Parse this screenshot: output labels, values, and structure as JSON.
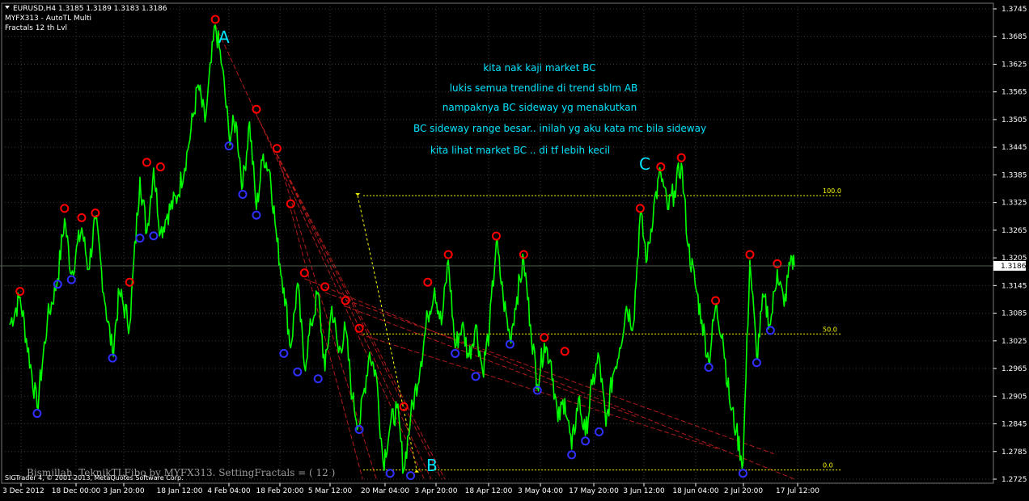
{
  "header": {
    "symbol_line": "EURUSD,H4  1.3185 1.3189 1.3183 1.3186",
    "indicator_1": "MYFX313 - AutoTL Multi",
    "indicator_2": "Fractals  12 th Lvl"
  },
  "notes": [
    "kita nak kaji market BC",
    "lukis semua trendline di trend sblm AB",
    "nampaknya BC sideway yg menakutkan",
    "BC sideway range besar.. inilah yg aku kata mc bila sideway",
    "kita lihat market BC .. di tf lebih kecil"
  ],
  "point_labels": {
    "a": "A",
    "b": "B",
    "c": "C"
  },
  "fib_levels": [
    {
      "label": "100.0",
      "price": 1.334
    },
    {
      "label": "50.0",
      "price": 1.304
    },
    {
      "label": "0.0",
      "price": 1.2745
    }
  ],
  "current_price": "1.3186",
  "footer": {
    "caption": "Bismillah. TeknikTLFibo by MYFX313. SettingFractals = ( 12 )",
    "copyright": "SIGTrader 4, © 2001-2013, MetaQuotes Software Corp."
  },
  "colors": {
    "background": "#000000",
    "price_line": "#00ff00",
    "grid": "#3a3a3a",
    "fractal_up": "#ff0000",
    "fractal_down": "#2f2fff",
    "trendline": "#b21a1a",
    "fib": "#ffff00",
    "notes": "#00e5ff"
  },
  "chart_data": {
    "type": "line",
    "symbol": "EURUSD",
    "timeframe": "H4",
    "y_ticks": [
      "1.3745",
      "1.3685",
      "1.3625",
      "1.3565",
      "1.3505",
      "1.3445",
      "1.3385",
      "1.3325",
      "1.3265",
      "1.3205",
      "1.3145",
      "1.3085",
      "1.3025",
      "1.2965",
      "1.2905",
      "1.2845",
      "1.2785",
      "1.2725"
    ],
    "x_ticks": [
      "3 Dec 2012",
      "18 Dec 00:00",
      "3 Jan 20:00",
      "18 Jan 12:00",
      "4 Feb 04:00",
      "18 Feb 20:00",
      "5 Mar 12:00",
      "20 Mar 04:00",
      "3 Apr 20:00",
      "18 Apr 12:00",
      "3 May 04:00",
      "17 May 20:00",
      "3 Jun 12:00",
      "18 Jun 04:00",
      "2 Jul 20:00",
      "17 Jul 12:00"
    ],
    "ylim": [
      1.2725,
      1.3745
    ],
    "price_path": [
      [
        "3 Dec 2012",
        1.306
      ],
      [
        "6 Dec",
        1.312
      ],
      [
        "11 Dec",
        1.288
      ],
      [
        "14 Dec",
        1.307
      ],
      [
        "17 Dec",
        1.316
      ],
      [
        "19 Dec",
        1.329
      ],
      [
        "21 Dec",
        1.317
      ],
      [
        "24 Dec",
        1.327
      ],
      [
        "26 Dec",
        1.318
      ],
      [
        "28 Dec",
        1.329
      ],
      [
        "31 Dec",
        1.31
      ],
      [
        "2 Jan",
        1.3
      ],
      [
        "4 Jan",
        1.313
      ],
      [
        "7 Jan",
        1.306
      ],
      [
        "10 Jan",
        1.338
      ],
      [
        "12 Jan",
        1.326
      ],
      [
        "14 Jan",
        1.34
      ],
      [
        "16 Jan",
        1.326
      ],
      [
        "18 Jan",
        1.33
      ],
      [
        "21 Jan",
        1.334
      ],
      [
        "24 Jan",
        1.344
      ],
      [
        "27 Jan",
        1.358
      ],
      [
        "29 Jan",
        1.35
      ],
      [
        "1 Feb",
        1.371
      ],
      [
        "3 Feb",
        1.362
      ],
      [
        "5 Feb",
        1.347
      ],
      [
        "7 Feb",
        1.35
      ],
      [
        "9 Feb",
        1.336
      ],
      [
        "11 Feb",
        1.35
      ],
      [
        "13 Feb",
        1.331
      ],
      [
        "15 Feb",
        1.343
      ],
      [
        "17 Feb",
        1.339
      ],
      [
        "19 Feb",
        1.324
      ],
      [
        "21 Feb",
        1.314
      ],
      [
        "23 Feb",
        1.301
      ],
      [
        "25 Feb",
        1.315
      ],
      [
        "27 Feb",
        1.297
      ],
      [
        "1 Mar",
        1.306
      ],
      [
        "3 Mar",
        1.313
      ],
      [
        "5 Mar",
        1.296
      ],
      [
        "7 Mar",
        1.31
      ],
      [
        "9 Mar",
        1.3
      ],
      [
        "11 Mar",
        1.305
      ],
      [
        "13 Mar",
        1.29
      ],
      [
        "15 Mar",
        1.284
      ],
      [
        "18 Mar",
        1.3
      ],
      [
        "20 Mar",
        1.295
      ],
      [
        "22 Mar",
        1.276
      ],
      [
        "24 Mar",
        1.284
      ],
      [
        "26 Mar",
        1.288
      ],
      [
        "28 Mar",
        1.2745
      ],
      [
        "30 Mar",
        1.286
      ],
      [
        "2 Apr",
        1.298
      ],
      [
        "4 Apr",
        1.308
      ],
      [
        "6 Apr",
        1.314
      ],
      [
        "8 Apr",
        1.306
      ],
      [
        "10 Apr",
        1.32
      ],
      [
        "12 Apr",
        1.301
      ],
      [
        "14 Apr",
        1.306
      ],
      [
        "16 Apr",
        1.299
      ],
      [
        "18 Apr",
        1.306
      ],
      [
        "20 Apr",
        1.296
      ],
      [
        "22 Apr",
        1.305
      ],
      [
        "24 Apr",
        1.324
      ],
      [
        "26 Apr",
        1.312
      ],
      [
        "28 Apr",
        1.303
      ],
      [
        "30 Apr",
        1.312
      ],
      [
        "2 May",
        1.32
      ],
      [
        "4 May",
        1.306
      ],
      [
        "6 May",
        1.293
      ],
      [
        "8 May",
        1.302
      ],
      [
        "10 May",
        1.298
      ],
      [
        "12 May",
        1.285
      ],
      [
        "14 May",
        1.29
      ],
      [
        "16 May",
        1.279
      ],
      [
        "18 May",
        1.29
      ],
      [
        "20 May",
        1.282
      ],
      [
        "22 May",
        1.293
      ],
      [
        "24 May",
        1.299
      ],
      [
        "26 May",
        1.284
      ],
      [
        "28 May",
        1.295
      ],
      [
        "30 May",
        1.301
      ],
      [
        "1 Jun",
        1.31
      ],
      [
        "3 Jun",
        1.306
      ],
      [
        "5 Jun",
        1.33
      ],
      [
        "7 Jun",
        1.32
      ],
      [
        "9 Jun",
        1.332
      ],
      [
        "11 Jun",
        1.339
      ],
      [
        "13 Jun",
        1.331
      ],
      [
        "15 Jun",
        1.335
      ],
      [
        "17 Jun",
        1.341
      ],
      [
        "19 Jun",
        1.323
      ],
      [
        "21 Jun",
        1.315
      ],
      [
        "23 Jun",
        1.307
      ],
      [
        "25 Jun",
        1.298
      ],
      [
        "27 Jun",
        1.31
      ],
      [
        "29 Jun",
        1.304
      ],
      [
        "1 Jul",
        1.29
      ],
      [
        "3 Jul",
        1.283
      ],
      [
        "5 Jul",
        1.276
      ],
      [
        "7 Jul",
        1.32
      ],
      [
        "9 Jul",
        1.299
      ],
      [
        "11 Jul",
        1.312
      ],
      [
        "13 Jul",
        1.306
      ],
      [
        "15 Jul",
        1.318
      ],
      [
        "17 Jul",
        1.31
      ],
      [
        "19 Jul",
        1.321
      ],
      [
        "20 Jul",
        1.3186
      ]
    ],
    "fractals_up": [
      [
        "6 Dec",
        1.312
      ],
      [
        "19 Dec",
        1.33
      ],
      [
        "24 Dec",
        1.328
      ],
      [
        "28 Dec",
        1.329
      ],
      [
        "7 Jan",
        1.314
      ],
      [
        "12 Jan",
        1.34
      ],
      [
        "16 Jan",
        1.339
      ],
      [
        "1 Feb",
        1.371
      ],
      [
        "13 Feb",
        1.3515
      ],
      [
        "19 Feb",
        1.343
      ],
      [
        "23 Feb",
        1.331
      ],
      [
        "27 Feb",
        1.316
      ],
      [
        "5 Mar",
        1.313
      ],
      [
        "11 Mar",
        1.31
      ],
      [
        "15 Mar",
        1.304
      ],
      [
        "28 Mar",
        1.287
      ],
      [
        "4 Apr",
        1.314
      ],
      [
        "10 Apr",
        1.32
      ],
      [
        "24 Apr",
        1.324
      ],
      [
        "2 May",
        1.32
      ],
      [
        "8 May",
        1.302
      ],
      [
        "14 May",
        1.299
      ],
      [
        "5 Jun",
        1.33
      ],
      [
        "11 Jun",
        1.339
      ],
      [
        "17 Jun",
        1.341
      ],
      [
        "27 Jun",
        1.31
      ],
      [
        "7 Jul",
        1.32
      ],
      [
        "15 Jul",
        1.318
      ]
    ],
    "fractals_down": [
      [
        "11 Dec",
        1.288
      ],
      [
        "17 Dec",
        1.316
      ],
      [
        "21 Dec",
        1.317
      ],
      [
        "2 Jan",
        1.3
      ],
      [
        "10 Jan",
        1.326
      ],
      [
        "14 Jan",
        1.3265
      ],
      [
        "5 Feb",
        1.346
      ],
      [
        "9 Feb",
        1.3355
      ],
      [
        "13 Feb",
        1.331
      ],
      [
        "21 Feb",
        1.301
      ],
      [
        "25 Feb",
        1.297
      ],
      [
        "3 Mar",
        1.2955
      ],
      [
        "15 Mar",
        1.2845
      ],
      [
        "24 Mar",
        1.275
      ],
      [
        "30 Mar",
        1.2745
      ],
      [
        "12 Apr",
        1.301
      ],
      [
        "18 Apr",
        1.296
      ],
      [
        "28 Apr",
        1.303
      ],
      [
        "6 May",
        1.293
      ],
      [
        "16 May",
        1.279
      ],
      [
        "20 May",
        1.282
      ],
      [
        "24 May",
        1.284
      ],
      [
        "25 Jun",
        1.298
      ],
      [
        "5 Jul",
        1.275
      ],
      [
        "9 Jul",
        1.299
      ],
      [
        "13 Jul",
        1.306
      ]
    ]
  }
}
